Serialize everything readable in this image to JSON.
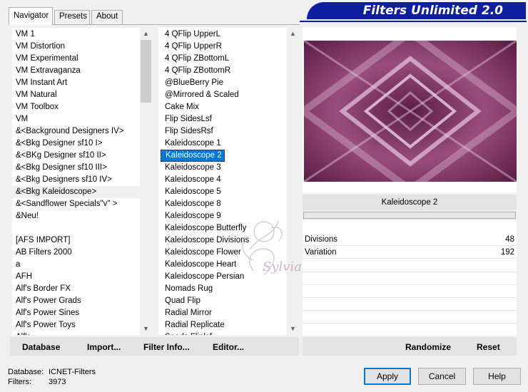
{
  "window": {
    "banner_title": "Filters Unlimited 2.0"
  },
  "tabs": [
    {
      "label": "Navigator",
      "active": true
    },
    {
      "label": "Presets",
      "active": false
    },
    {
      "label": "About",
      "active": false
    }
  ],
  "categories": {
    "items": [
      "VM 1",
      "VM Distortion",
      "VM Experimental",
      "VM Extravaganza",
      "VM Instant Art",
      "VM Natural",
      "VM Toolbox",
      "VM",
      "&<Background Designers IV>",
      "&<Bkg Designer sf10 I>",
      "&<BKg Designer sf10 II>",
      "&<Bkg Designer sf10 III>",
      "&<Bkg Designers sf10 IV>",
      "&<Bkg Kaleidoscope>",
      "&<Sandflower Specials\"v\" >",
      "&Neu!",
      "",
      "[AFS IMPORT]",
      "AB Filters 2000",
      "a",
      "AFH",
      "Alf's Border FX",
      "Alf's Power Grads",
      "Alf's Power Sines",
      "Alf's Power Toys",
      "Alf's ..."
    ],
    "hover_index": 13
  },
  "filters": {
    "items": [
      "4 QFlip UpperL",
      "4 QFlip UpperR",
      "4 QFlip ZBottomL",
      "4 QFlip ZBottomR",
      "@BlueBerry Pie",
      "@Mirrored & Scaled",
      "Cake Mix",
      "Flip SidesLsf",
      "Flip SidesRsf",
      "Kaleidoscope 1",
      "Kaleidoscope 2",
      "Kaleidoscope 3",
      "Kaleidoscope 4",
      "Kaleidoscope 5",
      "Kaleidoscope 8",
      "Kaleidoscope 9",
      "Kaleidoscope Butterfly",
      "Kaleidoscope Divisions",
      "Kaleidoscope Flower",
      "Kaleidoscope Heart",
      "Kaleidoscope Persian",
      "Nomads Rug",
      "Quad Flip",
      "Radial Mirror",
      "Radial Replicate",
      "Seeds Fliplsf"
    ],
    "selected_index": 10
  },
  "preview": {
    "filter_name": "Kaleidoscope 2",
    "colors": {
      "dark": "#5a1d43",
      "mid": "#9a4d7d",
      "light": "#e8c8e0"
    }
  },
  "params": [
    {
      "label": "Divisions",
      "value": "48"
    },
    {
      "label": "Variation",
      "value": "192"
    }
  ],
  "toolbar": {
    "database": "Database",
    "import": "Import...",
    "filter_info": "Filter Info...",
    "editor": "Editor...",
    "randomize": "Randomize",
    "reset": "Reset"
  },
  "footer": {
    "database_label": "Database:",
    "database_value": "ICNET-Filters",
    "filters_label": "Filters:",
    "filters_value": "3973"
  },
  "buttons": {
    "apply": "Apply",
    "cancel": "Cancel",
    "help": "Help"
  },
  "watermark": {
    "text": "Sylviane"
  }
}
